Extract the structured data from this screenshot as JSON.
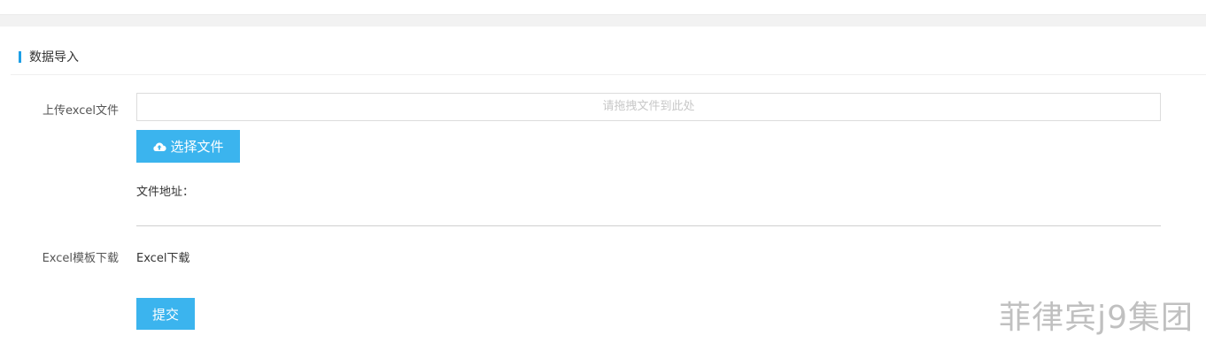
{
  "section": {
    "title": "数据导入"
  },
  "upload": {
    "label": "上传excel文件",
    "drop_placeholder": "请拖拽文件到此处",
    "choose_button_label": "选择文件",
    "file_address_label": "文件地址："
  },
  "template": {
    "label": "Excel模板下载",
    "link_text": "Excel下载"
  },
  "actions": {
    "submit_label": "提交"
  },
  "watermark": {
    "text": "菲律宾j9集团"
  },
  "colors": {
    "accent": "#3bb4ee",
    "marker": "#1e9fe6"
  },
  "icons": {
    "upload": "cloud-upload-icon"
  }
}
